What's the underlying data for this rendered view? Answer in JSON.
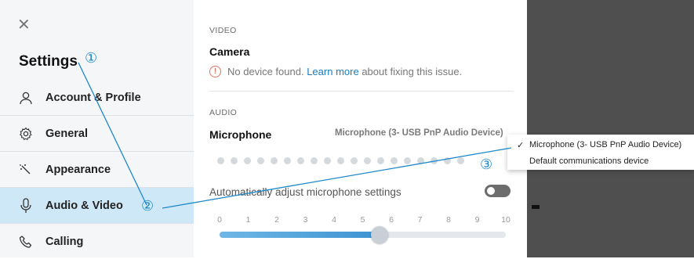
{
  "sidebar": {
    "close_glyph": "✕",
    "title": "Settings",
    "items": [
      {
        "label": "Account & Profile",
        "icon": "person-icon"
      },
      {
        "label": "General",
        "icon": "gear-icon"
      },
      {
        "label": "Appearance",
        "icon": "sparkle-icon"
      },
      {
        "label": "Audio & Video",
        "icon": "microphone-icon",
        "active": true
      },
      {
        "label": "Calling",
        "icon": "phone-icon"
      }
    ]
  },
  "video": {
    "section_label": "VIDEO",
    "camera_title": "Camera",
    "warning_icon": "!",
    "warning_text_before": "No device found. ",
    "warning_link": "Learn more",
    "warning_text_after": " about fixing this issue."
  },
  "audio": {
    "section_label": "AUDIO",
    "microphone_title": "Microphone",
    "microphone_value": "Microphone (3- USB PnP Audio Device)",
    "auto_adjust_label": "Automatically adjust microphone settings",
    "auto_adjust_on": false,
    "slider_ticks": [
      "0",
      "1",
      "2",
      "3",
      "4",
      "5",
      "6",
      "7",
      "8",
      "9",
      "10"
    ],
    "slider_value": 5.6,
    "slider_max": 10
  },
  "dropdown": {
    "options": [
      {
        "label": "Microphone (3- USB PnP Audio Device)",
        "selected": true,
        "check": "✓"
      },
      {
        "label": "Default communications device",
        "selected": false,
        "check": ""
      }
    ]
  },
  "annotations": [
    "①",
    "②",
    "③"
  ],
  "colors": {
    "accent": "#1e88c9",
    "active_nav": "#cfe8f7",
    "link": "#1a7bc4",
    "warning": "#e2725b",
    "dark_panel": "#4f4f4f"
  }
}
